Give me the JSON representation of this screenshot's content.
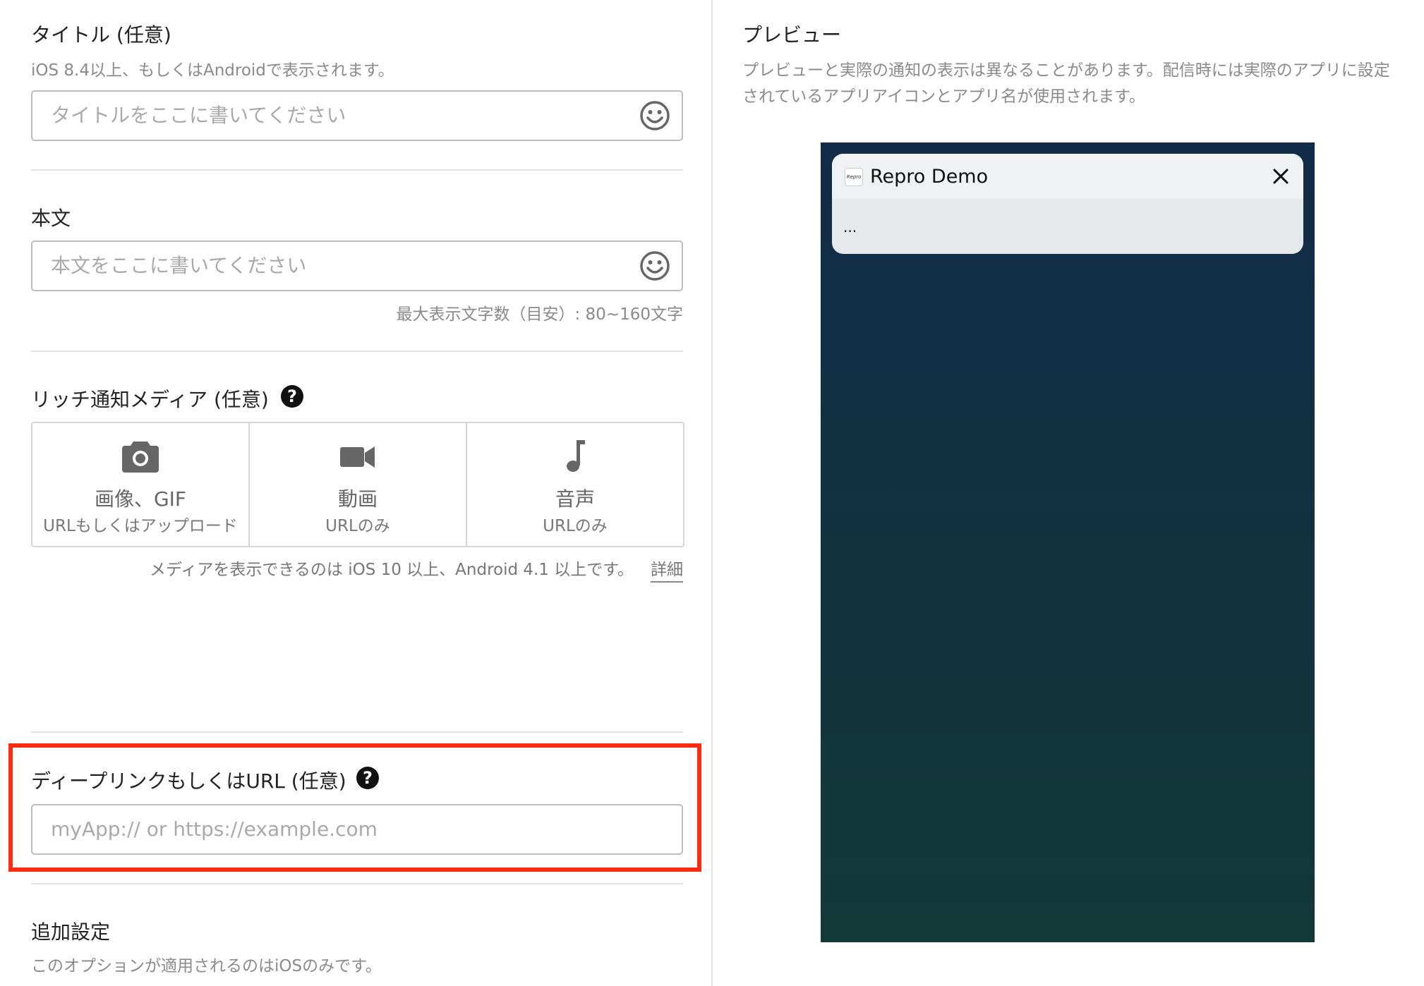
{
  "title_field": {
    "label": "タイトル (任意)",
    "hint": "iOS 8.4以上、もしくはAndroidで表示されます。",
    "placeholder": "タイトルをここに書いてください"
  },
  "body_field": {
    "label": "本文",
    "placeholder": "本文をここに書いてください",
    "char_hint": "最大表示文字数（目安）: 80~160文字"
  },
  "rich_media": {
    "label": "リッチ通知メディア (任意)",
    "options": [
      {
        "title": "画像、GIF",
        "sub": "URLもしくはアップロード",
        "icon": "camera-icon"
      },
      {
        "title": "動画",
        "sub": "URLのみ",
        "icon": "video-camera-icon"
      },
      {
        "title": "音声",
        "sub": "URLのみ",
        "icon": "music-note-icon"
      }
    ],
    "note": "メディアを表示できるのは iOS 10 以上、Android 4.1 以上です。",
    "detail_link": "詳細"
  },
  "deeplink_field": {
    "label": "ディープリンクもしくはURL (任意)",
    "placeholder": "myApp:// or https://example.com"
  },
  "additional": {
    "label": "追加設定",
    "hint": "このオプションが適用されるのはiOSのみです。"
  },
  "preview": {
    "title": "プレビュー",
    "description": "プレビューと実際の通知の表示は異なることがあります。配信時には実際のアプリに設定されているアプリアイコンとアプリ名が使用されます。",
    "app_icon_text": "Repro",
    "app_name": "Repro Demo",
    "body_text": "..."
  },
  "colors": {
    "highlight": "#ff2a12",
    "phone_top": "#122b48",
    "phone_bottom": "#133838"
  }
}
